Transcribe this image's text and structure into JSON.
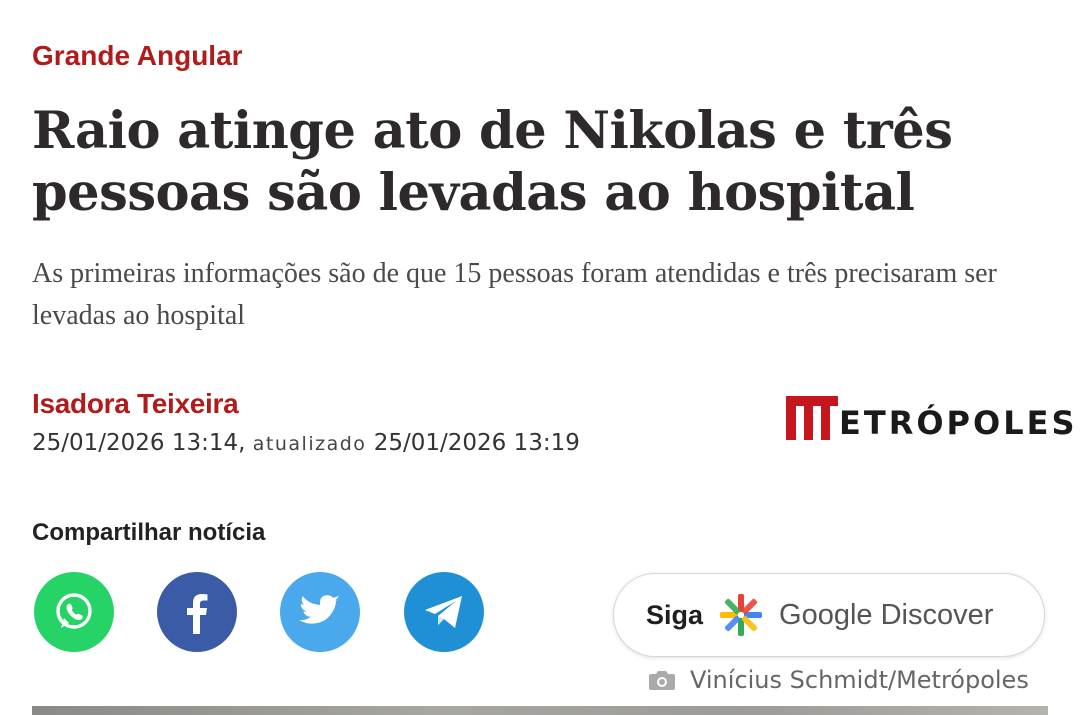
{
  "article": {
    "category": "Grande Angular",
    "headline": "Raio atinge ato de Nikolas e três pessoas são levadas ao hospital",
    "subtitle": "As primeiras informações são de que 15 pessoas foram atendidas e três precisaram ser levadas ao hospital",
    "author": "Isadora Teixeira",
    "published": "25/01/2026 13:14,",
    "updated_label": "atualizado",
    "updated": "25/01/2026 13:19"
  },
  "brand": {
    "logo_text": "ETRÓPOLES",
    "accent_color": "#b11b1b"
  },
  "share": {
    "label": "Compartilhar notícia",
    "buttons": [
      {
        "name": "whatsapp",
        "icon": "whatsapp-icon",
        "color": "#25d366"
      },
      {
        "name": "facebook",
        "icon": "facebook-icon",
        "color": "#3b5ba6"
      },
      {
        "name": "twitter",
        "icon": "twitter-icon",
        "color": "#4aa8ec"
      },
      {
        "name": "telegram",
        "icon": "telegram-icon",
        "color": "#1f8fd6"
      }
    ]
  },
  "discover": {
    "prefix": "Siga",
    "label": "Google Discover"
  },
  "photo": {
    "credit": "Vinícius Schmidt/Metrópoles"
  }
}
